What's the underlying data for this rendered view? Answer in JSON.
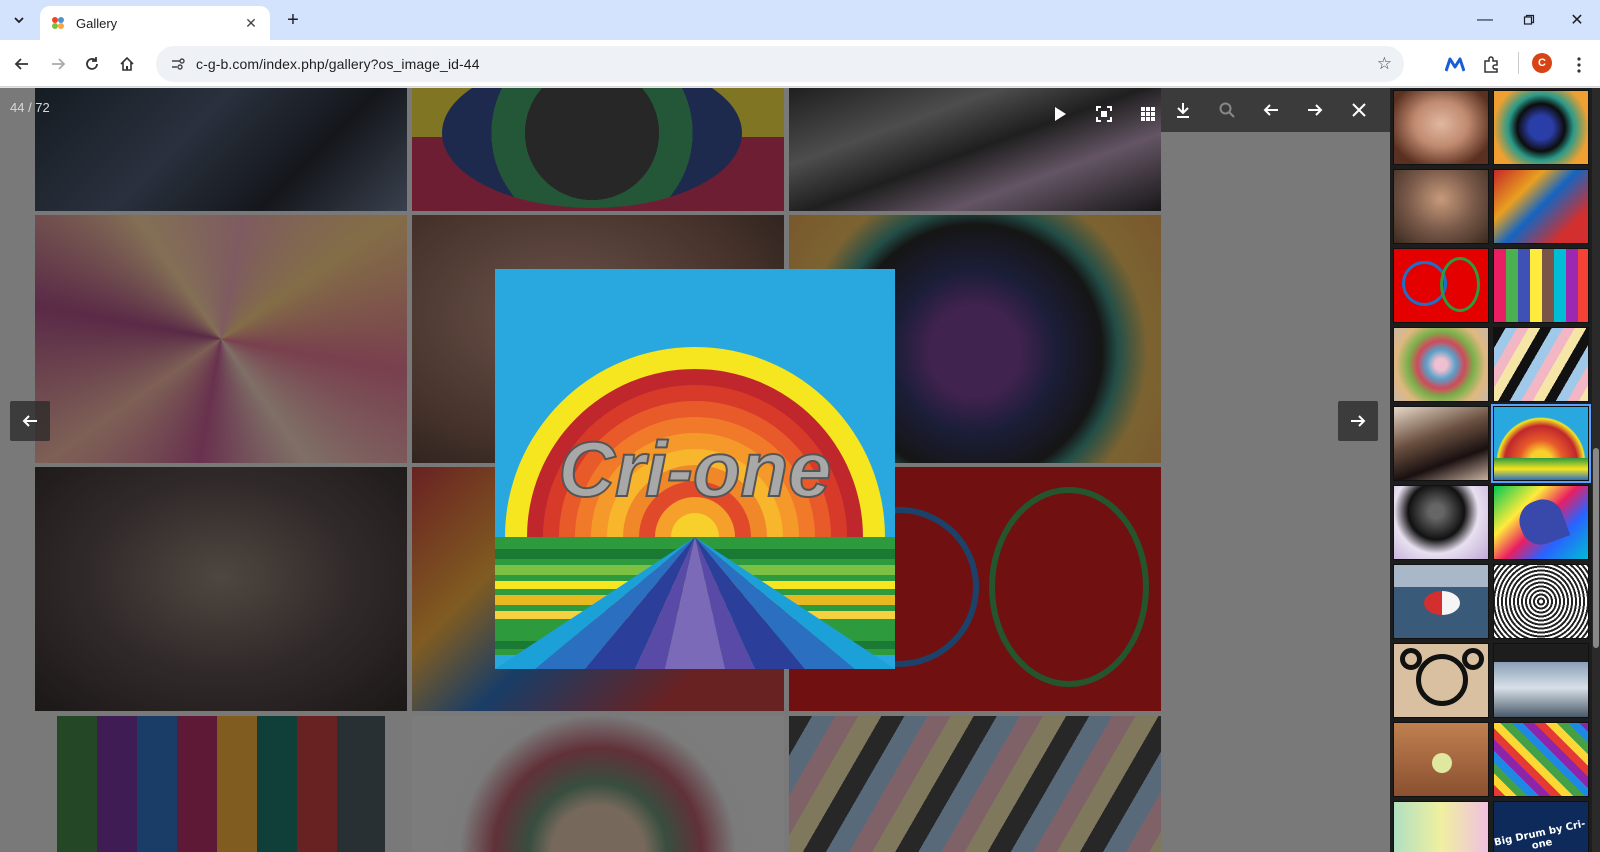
{
  "browser": {
    "tab_title": "Gallery",
    "url": "c-g-b.com/index.php/gallery?os_image_id-44",
    "profile_initial": "C"
  },
  "lightbox": {
    "counter": "44 / 72",
    "main_image_text": "Cri-one",
    "thumb_text_big_drum": "Big Drum by Cri-one"
  },
  "colors": {
    "tab_bar": "#d3e3fd",
    "overlay": "#1e1e1e",
    "panel": "#1d1d1d",
    "accent": "#5aa0ff"
  }
}
